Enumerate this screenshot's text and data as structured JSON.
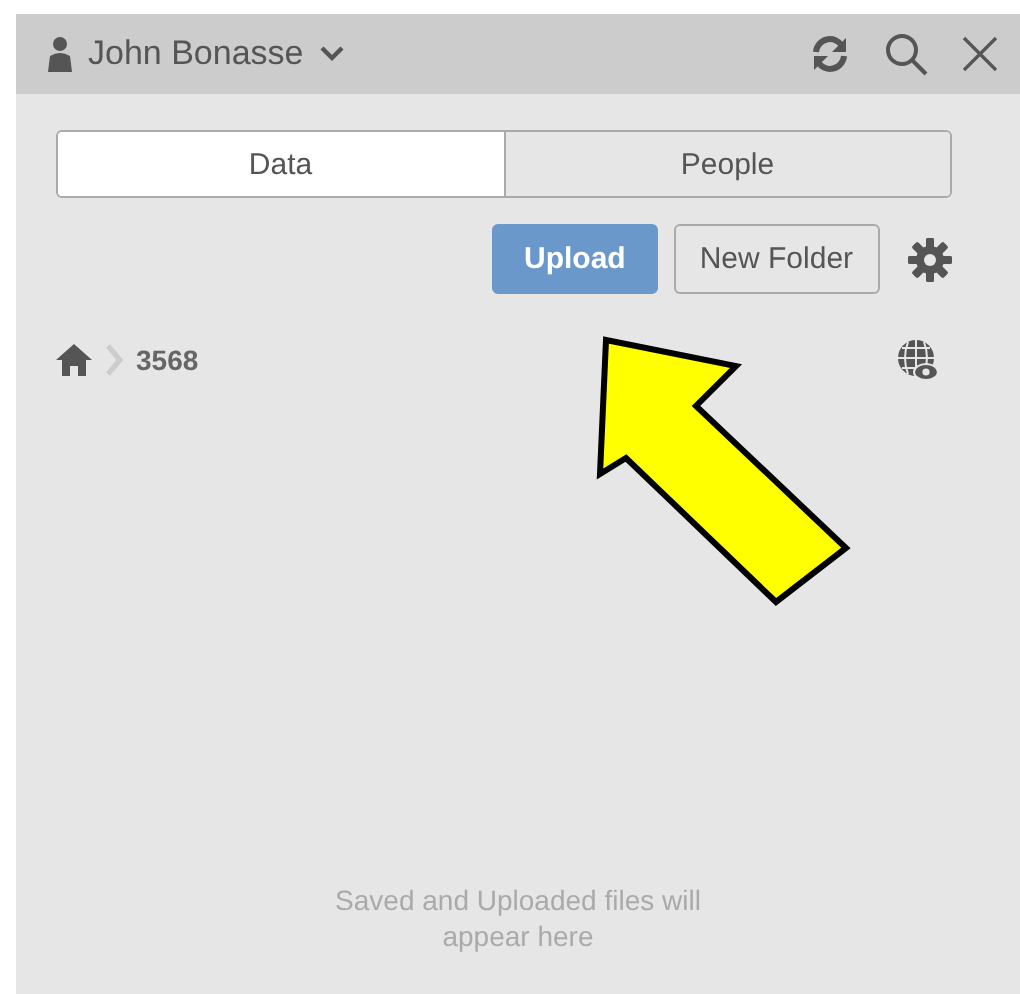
{
  "header": {
    "user": "John Bonasse"
  },
  "tabs": [
    {
      "label": "Data",
      "selected": true
    },
    {
      "label": "People",
      "selected": false
    }
  ],
  "actions": {
    "primary": "Upload",
    "secondary": "New Folder"
  },
  "breadcrumb": {
    "folder": "3568"
  },
  "empty_message": "Saved and Uploaded files will appear here"
}
